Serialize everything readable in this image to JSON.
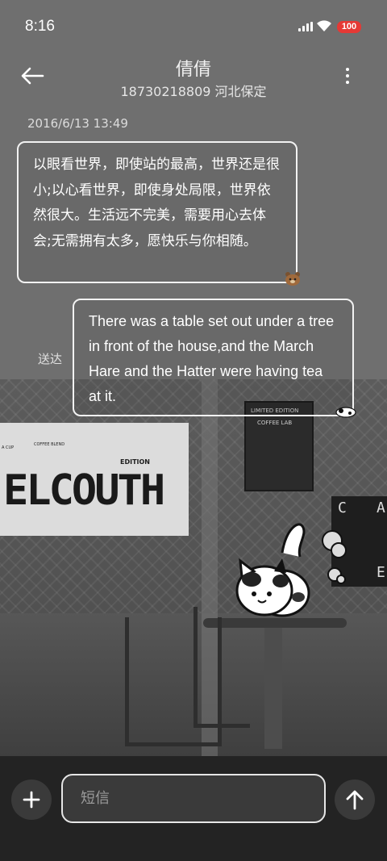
{
  "status_bar": {
    "time": "8:16",
    "battery": "100",
    "battery_color": "#e53935"
  },
  "header": {
    "contact_name": "倩倩",
    "contact_sub": "18730218809 河北保定",
    "back_icon": "arrow-left-icon",
    "more_icon": "more-vertical-icon"
  },
  "conversation": {
    "timestamp": "2016/6/13 13:49",
    "incoming": {
      "text": "以眼看世界，即使站的最高，世界还是很小;以心看世界，即使身处局限，世界依然很大。生活远不完美，需要用心去体会;无需拥有太多，愿快乐与你相随。"
    },
    "outgoing": {
      "text": "There was a table set out under a tree in front of the house,and the March Hare and the Hatter were having tea at it.",
      "status": "送达"
    }
  },
  "background": {
    "sign_text": "ELCOUTH",
    "sign_tag": "EDITION",
    "sign_small_left": "A CUP",
    "sign_small_mid": "COFFEE BLEND",
    "poster_line1": "LIMITED EDITION",
    "poster_line2": "COFFEE LAB",
    "board_letters": [
      "C",
      "A",
      "E"
    ]
  },
  "composer": {
    "placeholder": "短信",
    "add_icon": "plus-icon",
    "send_icon": "arrow-up-icon"
  },
  "colors": {
    "bubble_border": "#f2f2f2",
    "bar_bg": "#232323",
    "button_bg": "#3a3a3a"
  }
}
